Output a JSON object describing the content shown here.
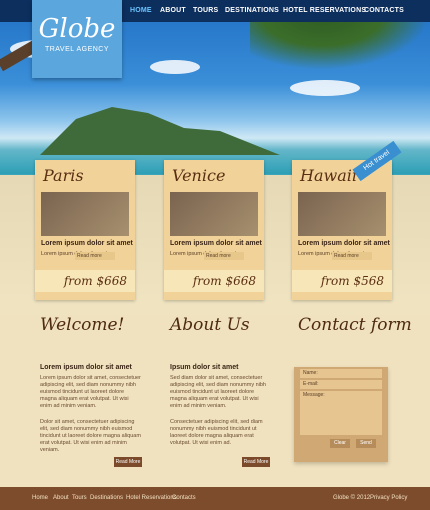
{
  "nav": {
    "items": [
      "HOME",
      "ABOUT",
      "TOURS",
      "DESTINATIONS",
      "HOTEL RESERVATIONS",
      "CONTACTS"
    ]
  },
  "logo": {
    "title": "Globe",
    "subtitle": "TRAVEL AGENCY"
  },
  "cards": [
    {
      "city": "Paris",
      "heading": "Lorem ipsum dolor sit amet",
      "body": "Lorem ipsum dolor sit amet,",
      "more": "Read more",
      "price": "from $668"
    },
    {
      "city": "Venice",
      "heading": "Lorem ipsum dolor sit amet",
      "body": "Lorem ipsum dolor sit amet,",
      "more": "Read more",
      "price": "from $668"
    },
    {
      "city": "Hawaii",
      "heading": "Lorem ipsum dolor sit amet",
      "body": "Lorem ipsum dolor sit amet,",
      "more": "Read more",
      "price": "from $568",
      "ribbon": "Hot travel"
    }
  ],
  "welcome": {
    "title": "Welcome!",
    "heading": "Lorem ipsum dolor sit amet",
    "p1": "Lorem ipsum dolor sit amet, consectetuer adipiscing elit, sed diam nonummy nibh euismod tincidunt ut laoreet dolore magna aliquam erat volutpat. Ut wisi enim ad minim veniam.",
    "p2": "Dolor sit amet, consectetuer adipiscing elit, sed diam nonummy nibh euismod tincidunt ut laoreet dolore magna aliquam erat volutpat. Ut wisi enim ad minim veniam.",
    "read_more": "Read More"
  },
  "about": {
    "title": "About Us",
    "heading": "Ipsum dolor sit amet",
    "p1": "Sed diam dolor sit amet, consectetuer adipiscing elit, sed diam nonummy nibh euismod tincidunt ut laoreet dolore magna aliquam erat volutpat. Ut wisi enim ad minim veniam.",
    "p2": "Consectetuer adipiscing elit, sed diam nonummy nibh euismod tincidunt ut laoreet dolore magna aliquam erat volutpat. Ut wisi enim ad.",
    "read_more": "Read More"
  },
  "contact": {
    "title": "Contact form",
    "name_label": "Name:",
    "email_label": "E-mail:",
    "message_label": "Message:",
    "clear_label": "Clear",
    "send_label": "Send"
  },
  "footer": {
    "items": [
      "Home",
      "About",
      "Tours",
      "Destinations",
      "Hotel Reservations",
      "Contacts"
    ],
    "copyright": "Globe © 2012",
    "privacy": "Privacy Policy"
  }
}
